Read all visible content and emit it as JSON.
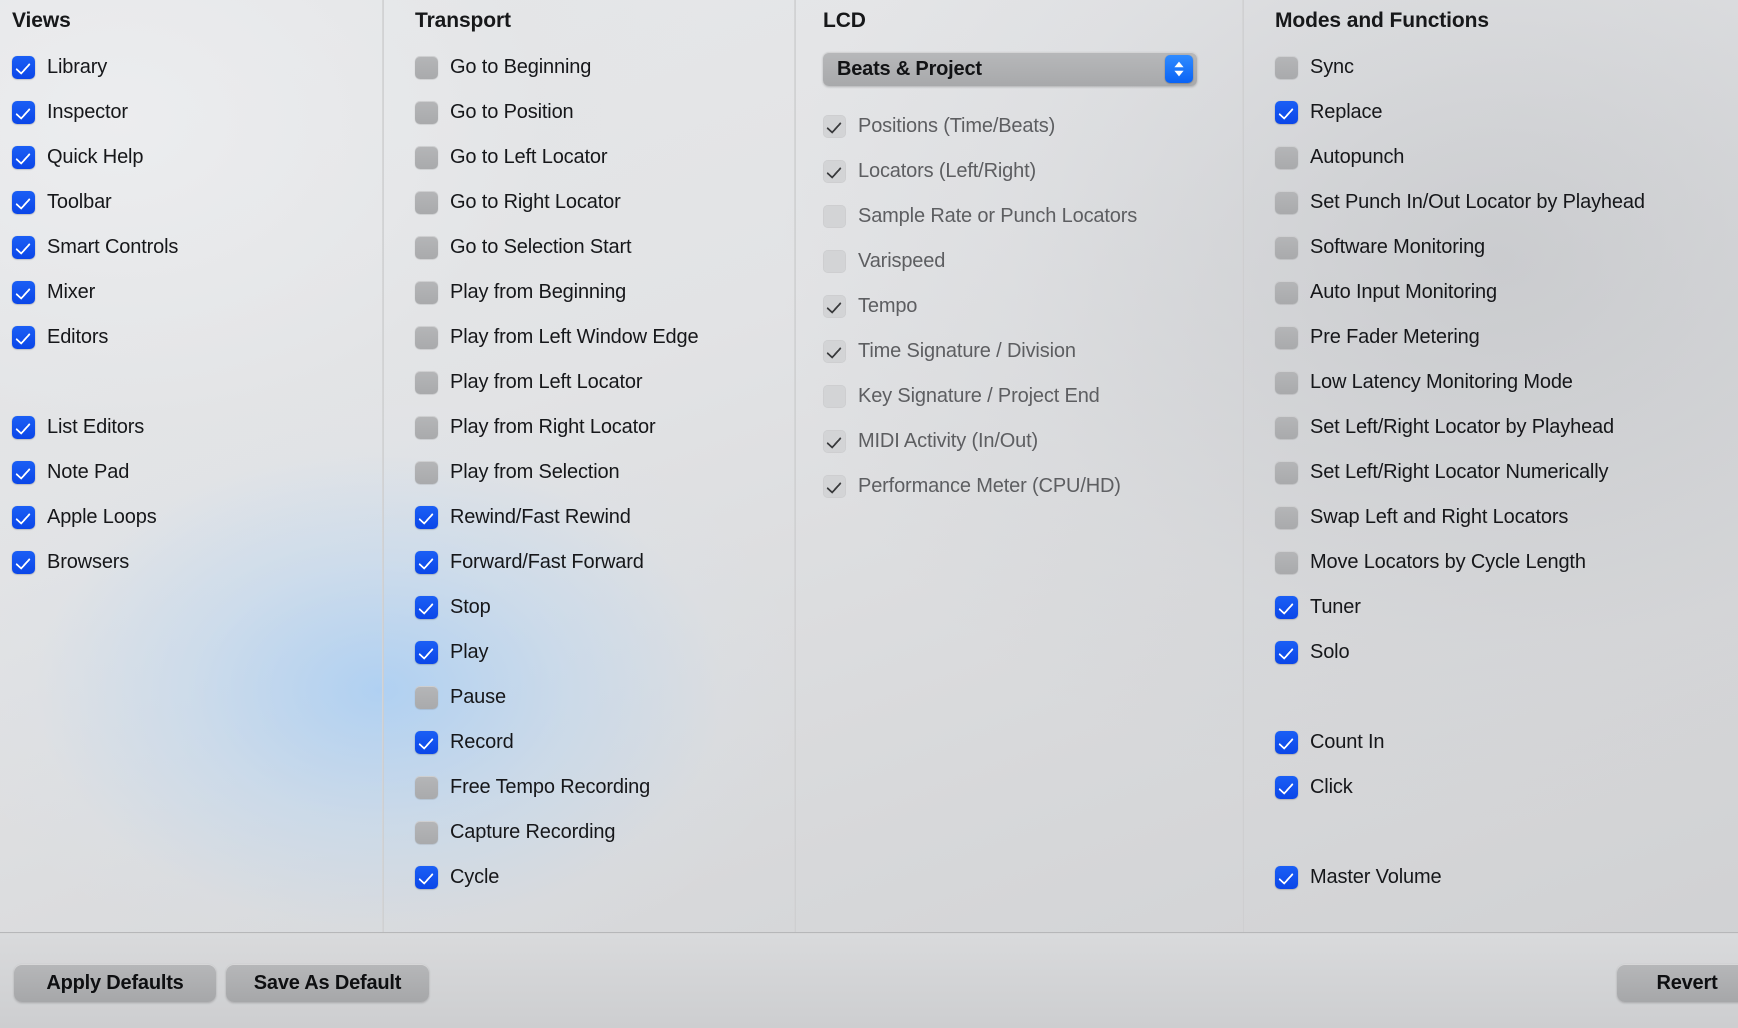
{
  "columns": {
    "views": {
      "title": "Views",
      "items": [
        {
          "label": "Library",
          "state": "on"
        },
        {
          "label": "Inspector",
          "state": "on"
        },
        {
          "label": "Quick Help",
          "state": "on"
        },
        {
          "label": "Toolbar",
          "state": "on"
        },
        {
          "label": "Smart Controls",
          "state": "on"
        },
        {
          "label": "Mixer",
          "state": "on"
        },
        {
          "label": "Editors",
          "state": "on"
        },
        {
          "label": "List Editors",
          "state": "on",
          "gap": true
        },
        {
          "label": "Note Pad",
          "state": "on"
        },
        {
          "label": "Apple Loops",
          "state": "on"
        },
        {
          "label": "Browsers",
          "state": "on"
        }
      ]
    },
    "transport": {
      "title": "Transport",
      "items": [
        {
          "label": "Go to Beginning",
          "state": "off"
        },
        {
          "label": "Go to Position",
          "state": "off"
        },
        {
          "label": "Go to Left Locator",
          "state": "off"
        },
        {
          "label": "Go to Right Locator",
          "state": "off"
        },
        {
          "label": "Go to Selection Start",
          "state": "off"
        },
        {
          "label": "Play from Beginning",
          "state": "off"
        },
        {
          "label": "Play from Left Window Edge",
          "state": "off"
        },
        {
          "label": "Play from Left Locator",
          "state": "off"
        },
        {
          "label": "Play from Right Locator",
          "state": "off"
        },
        {
          "label": "Play from Selection",
          "state": "off"
        },
        {
          "label": "Rewind/Fast Rewind",
          "state": "on"
        },
        {
          "label": "Forward/Fast Forward",
          "state": "on"
        },
        {
          "label": "Stop",
          "state": "on"
        },
        {
          "label": "Play",
          "state": "on"
        },
        {
          "label": "Pause",
          "state": "off"
        },
        {
          "label": "Record",
          "state": "on"
        },
        {
          "label": "Free Tempo Recording",
          "state": "off"
        },
        {
          "label": "Capture Recording",
          "state": "off"
        },
        {
          "label": "Cycle",
          "state": "on"
        }
      ]
    },
    "lcd": {
      "title": "LCD",
      "popup": {
        "selected": "Beats & Project",
        "stepper_icon": "chevron-up-down-icon"
      },
      "items": [
        {
          "label": "Positions (Time/Beats)",
          "state": "on-dim"
        },
        {
          "label": "Locators (Left/Right)",
          "state": "on-dim"
        },
        {
          "label": "Sample Rate or Punch Locators",
          "state": "off-dim"
        },
        {
          "label": "Varispeed",
          "state": "off-dim"
        },
        {
          "label": "Tempo",
          "state": "on-dim"
        },
        {
          "label": "Time Signature / Division",
          "state": "on-dim"
        },
        {
          "label": "Key Signature / Project End",
          "state": "off-dim"
        },
        {
          "label": "MIDI Activity (In/Out)",
          "state": "on-dim"
        },
        {
          "label": "Performance Meter (CPU/HD)",
          "state": "on-dim"
        }
      ]
    },
    "modes": {
      "title": "Modes and Functions",
      "items": [
        {
          "label": "Sync",
          "state": "off"
        },
        {
          "label": "Replace",
          "state": "on"
        },
        {
          "label": "Autopunch",
          "state": "off"
        },
        {
          "label": "Set Punch In/Out Locator by Playhead",
          "state": "off"
        },
        {
          "label": "Software Monitoring",
          "state": "off"
        },
        {
          "label": "Auto Input Monitoring",
          "state": "off"
        },
        {
          "label": "Pre Fader Metering",
          "state": "off"
        },
        {
          "label": "Low Latency Monitoring Mode",
          "state": "off"
        },
        {
          "label": "Set Left/Right Locator by Playhead",
          "state": "off"
        },
        {
          "label": "Set Left/Right Locator Numerically",
          "state": "off"
        },
        {
          "label": "Swap Left and Right Locators",
          "state": "off"
        },
        {
          "label": "Move Locators by Cycle Length",
          "state": "off"
        },
        {
          "label": "Tuner",
          "state": "on"
        },
        {
          "label": "Solo",
          "state": "on"
        },
        {
          "label": "Count In",
          "state": "on",
          "gap": true
        },
        {
          "label": "Click",
          "state": "on"
        },
        {
          "label": "Master Volume",
          "state": "on",
          "gap": true
        }
      ]
    }
  },
  "footer": {
    "apply_defaults_label": "Apply Defaults",
    "save_as_default_label": "Save As Default",
    "revert_label": "Revert"
  },
  "colors": {
    "accent_checked": "#0b46e8",
    "accent_stepper": "#0a63f5",
    "unchecked_box": "#adaeb0",
    "disabled_box": "#d3d4d6",
    "window_bg": "#dfe0e2",
    "divider": "#b6b7b9"
  }
}
